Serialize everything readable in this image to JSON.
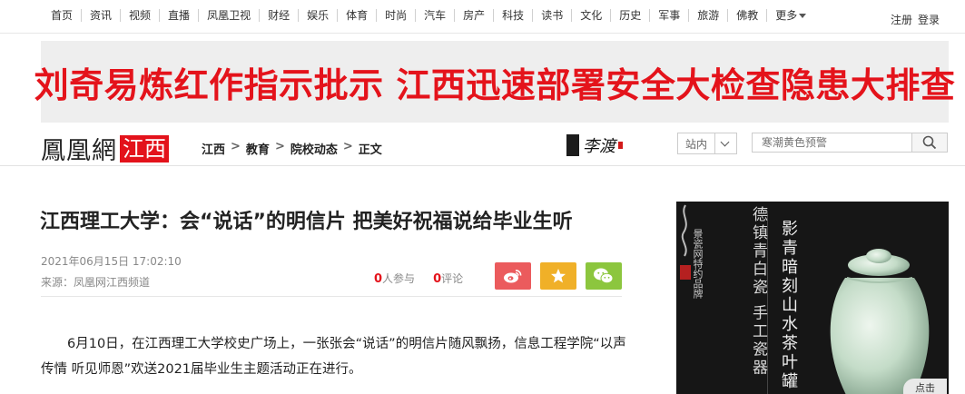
{
  "topnav": {
    "items": [
      "首页",
      "资讯",
      "视频",
      "直播",
      "凤凰卫视",
      "财经",
      "娱乐",
      "体育",
      "时尚",
      "汽车",
      "房产",
      "科技",
      "读书",
      "文化",
      "历史",
      "军事",
      "旅游",
      "佛教"
    ],
    "more_label": "更多",
    "register_label": "注册",
    "login_label": "登录"
  },
  "banner": {
    "text": "刘奇易炼红作指示批示 江西迅速部署安全大检查隐患大排查"
  },
  "header": {
    "logo_text": "鳳凰網",
    "logo_tag": "江西",
    "breadcrumb": [
      "江西",
      "教育",
      "院校动态",
      "正文"
    ],
    "sponsor_text": "李渡",
    "site_select": "站内",
    "search_placeholder": "寒潮黄色预警"
  },
  "article": {
    "title": "江西理工大学：会“说话”的明信片 把美好祝福说给毕业生听",
    "date": "2021年06月15日 17:02:10",
    "source": "来源：凤凰网江西频道",
    "participants_count": "0",
    "participants_label": "人参与",
    "comments_count": "0",
    "comments_label": "评论",
    "paragraph": "6月10日，在江西理工大学校史广场上，一张张会“说话”的明信片随风飘扬，信息工程学院“以声传情 听见师恩”欢送2021届毕业生主题活动正在进行。"
  },
  "ad": {
    "brand_text": "景瓷网特约品牌",
    "column1": "德镇青白瓷 手工瓷器",
    "column2": "影青暗刻山水茶叶罐",
    "zoom_label": "点击"
  },
  "colors": {
    "accent_red": "#e4131b",
    "weibo": "#eb5b5d",
    "favorite": "#f0b028",
    "wechat": "#8cc63e"
  }
}
